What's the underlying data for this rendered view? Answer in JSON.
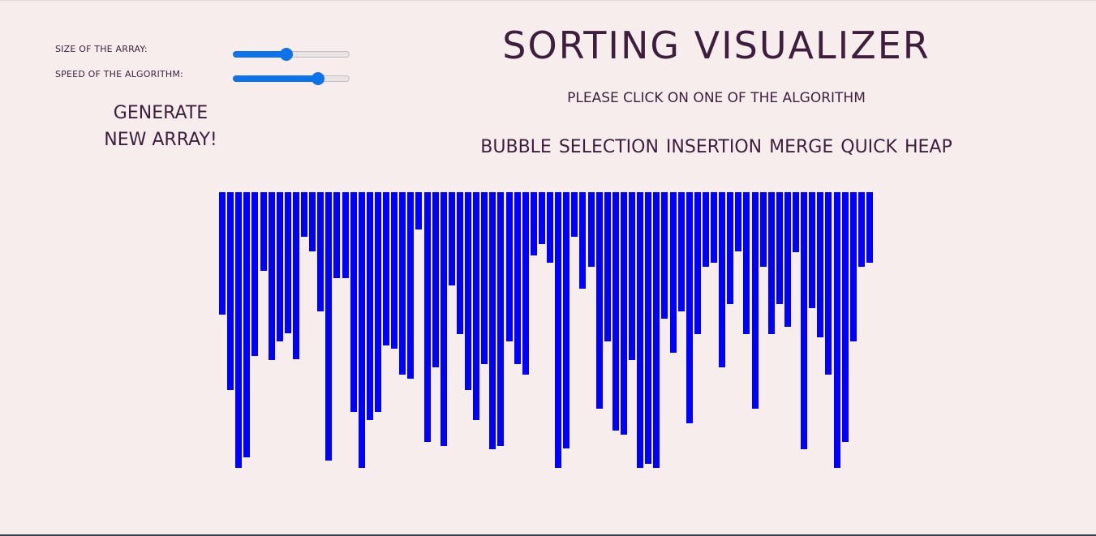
{
  "controls": {
    "size_label": "SIZE OF THE ARRAY:",
    "size_value": 0.46,
    "speed_label": "SPEED OF THE ALGORITHM:",
    "speed_value": 0.73,
    "generate_line1": "GENERATE",
    "generate_line2": "NEW ARRAY!"
  },
  "header": {
    "title": "SORTING VISUALIZER",
    "instruction": "PLEASE CLICK ON ONE OF THE ALGORITHM"
  },
  "algorithms": [
    "BUBBLE",
    "SELECTION",
    "INSERTION",
    "MERGE",
    "QUICK",
    "HEAP"
  ],
  "colors": {
    "background": "#f8eded",
    "text": "#3d1f3d",
    "bar": "#0000ff",
    "slider_accent": "#0f72e6"
  },
  "array": {
    "values": [
      151,
      244,
      340,
      327,
      202,
      97,
      207,
      184,
      174,
      206,
      55,
      73,
      147,
      331,
      106,
      106,
      271,
      340,
      281,
      271,
      189,
      193,
      225,
      230,
      46,
      308,
      216,
      313,
      115,
      175,
      244,
      281,
      212,
      317,
      313,
      184,
      212,
      225,
      78,
      64,
      87,
      340,
      316,
      55,
      119,
      92,
      267,
      184,
      294,
      299,
      207,
      340,
      335,
      340,
      156,
      198,
      147,
      285,
      175,
      92,
      87,
      216,
      138,
      73,
      175,
      267,
      92,
      175,
      138,
      166,
      74,
      317,
      143,
      179,
      225,
      340,
      308,
      184,
      92,
      87
    ]
  }
}
